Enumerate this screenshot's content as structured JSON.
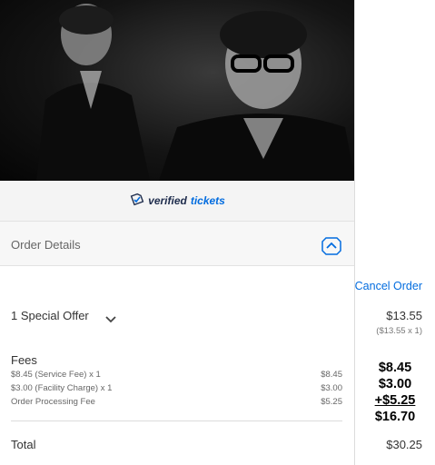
{
  "verified": {
    "word1": "verified",
    "word2": "tickets"
  },
  "order": {
    "title": "Order Details",
    "cancel_label": "Cancel Order",
    "offer_label": "1 Special Offer",
    "offer_price": "$13.55",
    "offer_sub": "($13.55 x 1)",
    "fees_title": "Fees",
    "fees": [
      {
        "label": "$8.45 (Service Fee) x 1",
        "value": "$8.45"
      },
      {
        "label": "$3.00 (Facility Charge) x 1",
        "value": "$3.00"
      },
      {
        "label": "Order Processing Fee",
        "value": "$5.25"
      }
    ],
    "total_label": "Total",
    "total_value": "$30.25"
  },
  "calc": {
    "line1": "$8.45",
    "line2": "$3.00",
    "line3": "+$5.25",
    "line4": "$16.70"
  },
  "colors": {
    "link": "#026cdf",
    "brand_dark": "#1f2d4d"
  },
  "icons": [
    "ticket-check-icon",
    "chevron-up-icon",
    "chevron-down-icon"
  ]
}
